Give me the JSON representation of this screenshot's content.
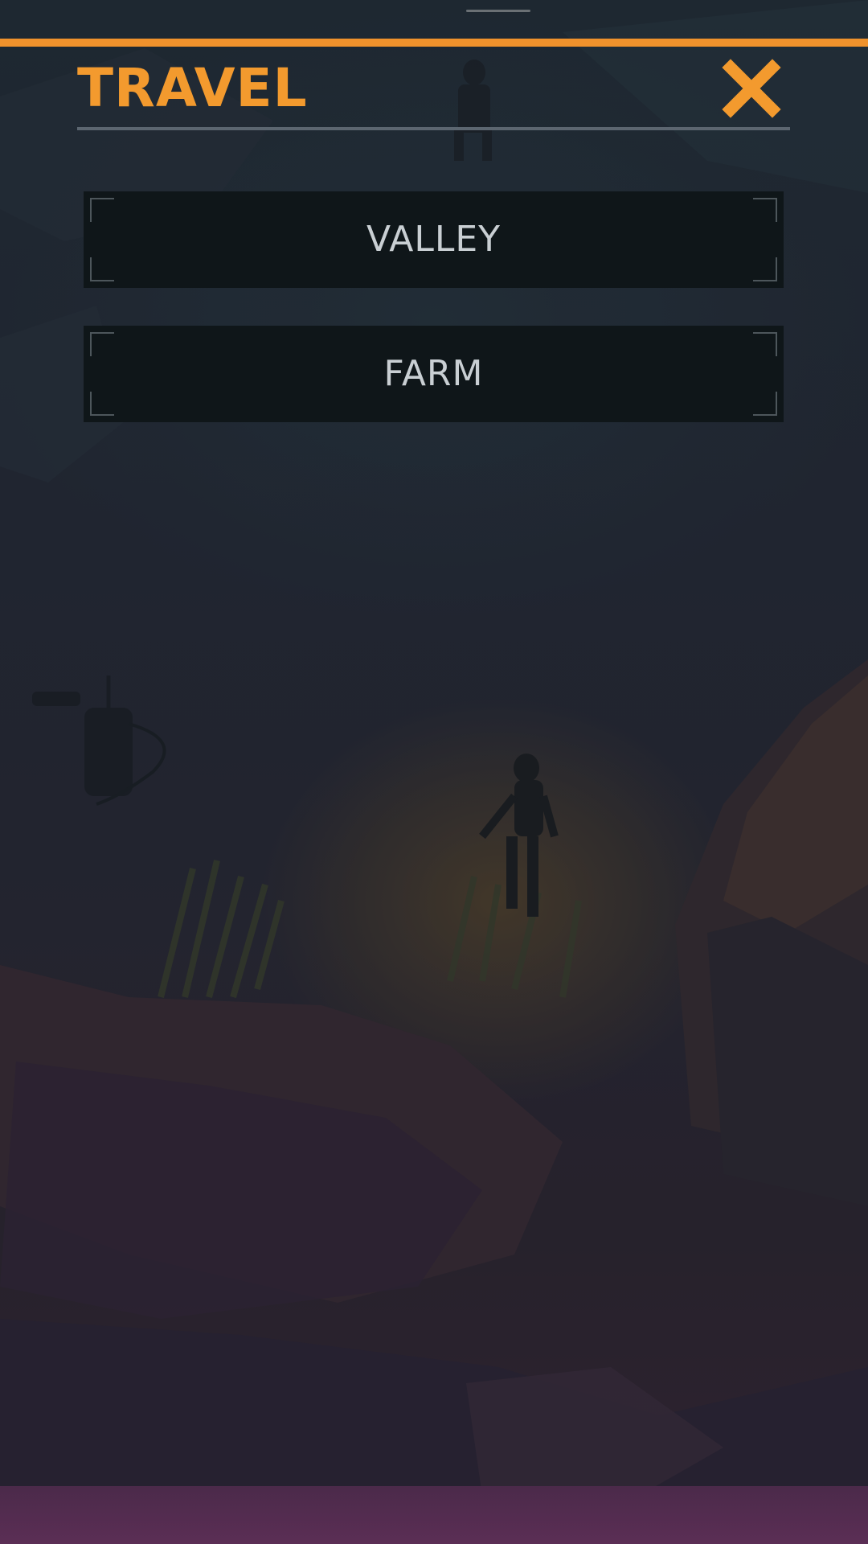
{
  "panel": {
    "title": "TRAVEL",
    "close_icon": "close-x-icon",
    "accent_color": "#f0922c"
  },
  "destinations": [
    {
      "label": "VALLEY"
    },
    {
      "label": "FARM"
    }
  ]
}
